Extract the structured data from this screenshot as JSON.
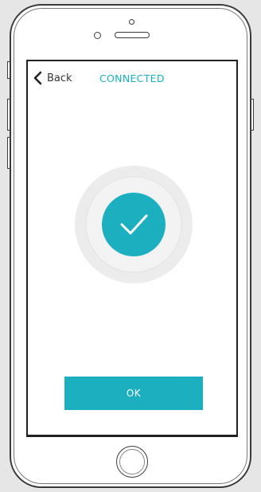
{
  "nav": {
    "back_label": "Back",
    "back_icon": "chevron-left-icon",
    "title": "CONNECTED"
  },
  "status": {
    "icon": "checkmark-icon",
    "state": "connected"
  },
  "actions": {
    "ok_label": "OK"
  },
  "colors": {
    "accent": "#1bafbf",
    "halo_outer": "#ececec",
    "halo_inner": "#f4f4f4",
    "text_dark": "#333333",
    "background": "#e6e6e6"
  }
}
